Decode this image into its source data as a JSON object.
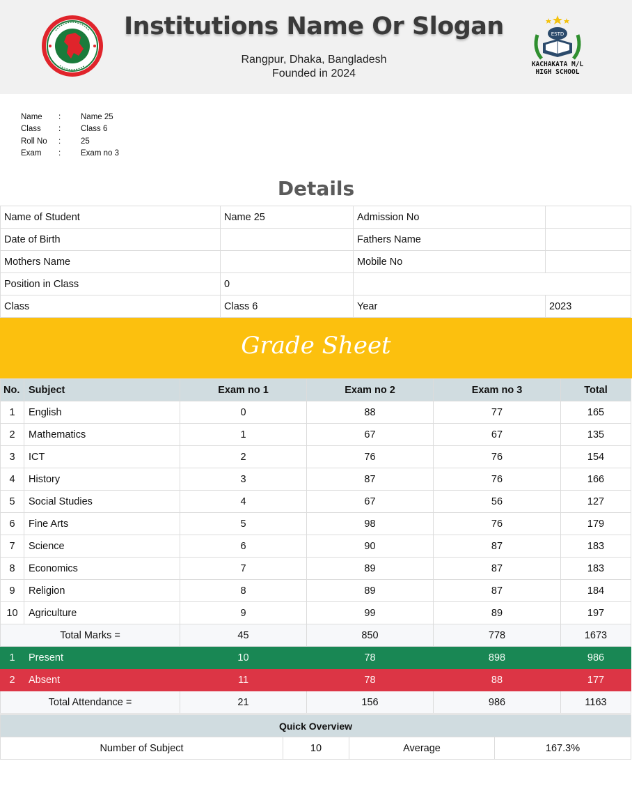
{
  "header": {
    "title": "Institutions Name Or Slogan",
    "address": "Rangpur, Dhaka, Bangladesh",
    "founded": "Founded in 2024",
    "school_line1": "KACHAKATA M/L",
    "school_line2": "HIGH SCHOOL",
    "estd_label": "ESTD",
    "left_logo_icon": "bangladesh-govt-seal-icon",
    "right_logo_icon": "school-book-crest-icon"
  },
  "student_info": [
    {
      "label": "Name",
      "sep": ":",
      "value": "Name 25"
    },
    {
      "label": "Class",
      "sep": ":",
      "value": "Class 6"
    },
    {
      "label": "Roll No",
      "sep": ":",
      "value": "25"
    },
    {
      "label": "Exam",
      "sep": ":",
      "value": "Exam no 3"
    }
  ],
  "details": {
    "title": "Details",
    "rows": [
      [
        "Name of Student",
        "Name 25",
        "Admission No",
        ""
      ],
      [
        "Date of Birth",
        "",
        "Fathers Name",
        ""
      ],
      [
        "Mothers Name",
        "",
        "Mobile No",
        ""
      ],
      [
        "Position in Class",
        "0",
        "",
        ""
      ],
      [
        "Class",
        "Class 6",
        "Year",
        "2023"
      ]
    ]
  },
  "grade_sheet": {
    "title": "Grade Sheet",
    "headers": [
      "No.",
      "Subject",
      "Exam no 1",
      "Exam no 2",
      "Exam no 3",
      "Total"
    ],
    "rows": [
      [
        "1",
        "English",
        "0",
        "88",
        "77",
        "165"
      ],
      [
        "2",
        "Mathematics",
        "1",
        "67",
        "67",
        "135"
      ],
      [
        "3",
        "ICT",
        "2",
        "76",
        "76",
        "154"
      ],
      [
        "4",
        "History",
        "3",
        "87",
        "76",
        "166"
      ],
      [
        "5",
        "Social Studies",
        "4",
        "67",
        "56",
        "127"
      ],
      [
        "6",
        "Fine Arts",
        "5",
        "98",
        "76",
        "179"
      ],
      [
        "7",
        "Science",
        "6",
        "90",
        "87",
        "183"
      ],
      [
        "8",
        "Economics",
        "7",
        "89",
        "87",
        "183"
      ],
      [
        "9",
        "Religion",
        "8",
        "89",
        "87",
        "184"
      ],
      [
        "10",
        "Agriculture",
        "9",
        "99",
        "89",
        "197"
      ]
    ],
    "total_marks": {
      "label": "Total Marks =",
      "values": [
        "45",
        "850",
        "778",
        "1673"
      ]
    },
    "present": {
      "no": "1",
      "label": "Present",
      "values": [
        "10",
        "78",
        "898",
        "986"
      ]
    },
    "absent": {
      "no": "2",
      "label": "Absent",
      "values": [
        "11",
        "78",
        "88",
        "177"
      ]
    },
    "total_attendance": {
      "label": "Total Attendance =",
      "values": [
        "21",
        "156",
        "986",
        "1163"
      ]
    }
  },
  "quick_overview": {
    "title": "Quick Overview",
    "subject_label": "Number of Subject",
    "subject_count": "10",
    "average_label": "Average",
    "average_value": "167.3%"
  },
  "colors": {
    "header_bg": "#f1f1f1",
    "grade_band": "#fcc00e",
    "table_head": "#d0dce0",
    "present_row": "#198754",
    "absent_row": "#dc3545",
    "seal_red": "#e0242b",
    "seal_green": "#1a7b3b"
  }
}
